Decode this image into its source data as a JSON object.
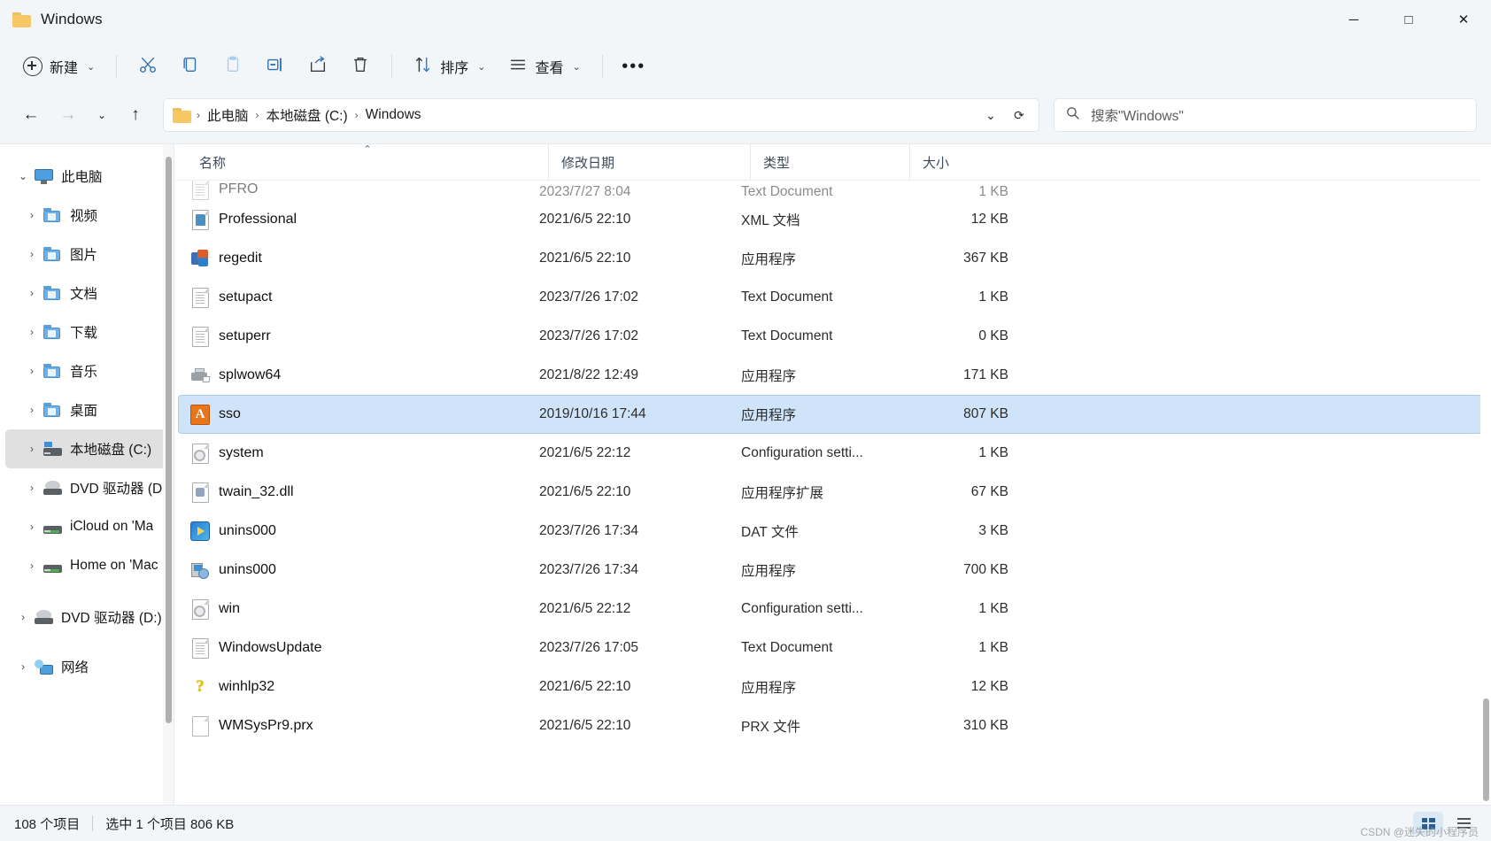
{
  "window": {
    "title": "Windows",
    "folder_icon": "folder-icon",
    "minimize_label": "─",
    "maximize_label": "□",
    "close_label": "✕"
  },
  "toolbar": {
    "new_label": "新建",
    "new_chevron": "⌄",
    "cut_icon": "cut-icon",
    "copy_icon": "copy-icon",
    "paste_icon": "paste-icon",
    "rename_icon": "rename-icon",
    "share_icon": "share-icon",
    "delete_icon": "delete-icon",
    "sort_label": "排序",
    "sort_chevron": "⌄",
    "view_label": "查看",
    "view_chevron": "⌄",
    "more_label": "•••"
  },
  "address": {
    "back_icon": "←",
    "forward_icon": "→",
    "recent_icon": "⌄",
    "up_icon": "↑",
    "breadcrumb": [
      {
        "label": "此电脑"
      },
      {
        "label": "本地磁盘 (C:)"
      },
      {
        "label": "Windows"
      }
    ],
    "separator": "›",
    "dropdown_icon": "⌄",
    "refresh_icon": "⟳",
    "search_icon": "search-icon",
    "search_placeholder": "搜索\"Windows\"",
    "search_value": ""
  },
  "sidebar": {
    "items": [
      {
        "label": "此电脑",
        "icon": "monitor-icon",
        "twisty": "⌄",
        "expanded": true,
        "indent": 0,
        "selected": false
      },
      {
        "label": "视频",
        "icon": "folder-videos-icon",
        "twisty": "›",
        "expanded": false,
        "indent": 1,
        "selected": false
      },
      {
        "label": "图片",
        "icon": "folder-pictures-icon",
        "twisty": "›",
        "expanded": false,
        "indent": 1,
        "selected": false
      },
      {
        "label": "文档",
        "icon": "folder-documents-icon",
        "twisty": "›",
        "expanded": false,
        "indent": 1,
        "selected": false
      },
      {
        "label": "下载",
        "icon": "folder-downloads-icon",
        "twisty": "›",
        "expanded": false,
        "indent": 1,
        "selected": false
      },
      {
        "label": "音乐",
        "icon": "folder-music-icon",
        "twisty": "›",
        "expanded": false,
        "indent": 1,
        "selected": false
      },
      {
        "label": "桌面",
        "icon": "folder-desktop-icon",
        "twisty": "›",
        "expanded": false,
        "indent": 1,
        "selected": false
      },
      {
        "label": "本地磁盘 (C:)",
        "icon": "drive-icon",
        "twisty": "›",
        "expanded": false,
        "indent": 1,
        "selected": true
      },
      {
        "label": "DVD 驱动器 (D",
        "icon": "cd-drive-icon",
        "twisty": "›",
        "expanded": false,
        "indent": 1,
        "selected": false
      },
      {
        "label": "iCloud on 'Ma",
        "icon": "network-drive-icon",
        "twisty": "›",
        "expanded": false,
        "indent": 1,
        "selected": false
      },
      {
        "label": "Home on 'Mac",
        "icon": "network-drive-icon",
        "twisty": "›",
        "expanded": false,
        "indent": 1,
        "selected": false
      },
      {
        "label": "DVD 驱动器 (D:)",
        "icon": "cd-drive-icon",
        "twisty": "›",
        "expanded": false,
        "indent": 0,
        "selected": false
      },
      {
        "label": "网络",
        "icon": "network-icon",
        "twisty": "›",
        "expanded": false,
        "indent": 0,
        "selected": false
      }
    ]
  },
  "filelist": {
    "columns": [
      {
        "label": "名称",
        "sorted": true,
        "sort_mark": "⌃"
      },
      {
        "label": "修改日期",
        "sorted": false,
        "sort_mark": ""
      },
      {
        "label": "类型",
        "sorted": false,
        "sort_mark": ""
      },
      {
        "label": "大小",
        "sorted": false,
        "sort_mark": ""
      }
    ],
    "partial_top_row": {
      "name": "PFRO",
      "date": "2023/7/27 8:04",
      "type": "Text Document",
      "size": "1 KB",
      "icon": "text-file-icon"
    },
    "rows": [
      {
        "name": "Professional",
        "date": "2021/6/5 22:10",
        "type": "XML 文档",
        "size": "12 KB",
        "icon": "xml-file-icon",
        "selected": false
      },
      {
        "name": "regedit",
        "date": "2021/6/5 22:10",
        "type": "应用程序",
        "size": "367 KB",
        "icon": "regedit-icon",
        "selected": false
      },
      {
        "name": "setupact",
        "date": "2023/7/26 17:02",
        "type": "Text Document",
        "size": "1 KB",
        "icon": "text-file-icon",
        "selected": false
      },
      {
        "name": "setuperr",
        "date": "2023/7/26 17:02",
        "type": "Text Document",
        "size": "0 KB",
        "icon": "text-file-icon",
        "selected": false
      },
      {
        "name": "splwow64",
        "date": "2021/8/22 12:49",
        "type": "应用程序",
        "size": "171 KB",
        "icon": "printer-icon",
        "selected": false
      },
      {
        "name": "sso",
        "date": "2019/10/16 17:44",
        "type": "应用程序",
        "size": "807 KB",
        "icon": "sso-app-icon",
        "selected": true
      },
      {
        "name": "system",
        "date": "2021/6/5 22:12",
        "type": "Configuration setti...",
        "size": "1 KB",
        "icon": "config-file-icon",
        "selected": false
      },
      {
        "name": "twain_32.dll",
        "date": "2021/6/5 22:10",
        "type": "应用程序扩展",
        "size": "67 KB",
        "icon": "dll-file-icon",
        "selected": false
      },
      {
        "name": "unins000",
        "date": "2023/7/26 17:34",
        "type": "DAT 文件",
        "size": "3 KB",
        "icon": "dat-file-icon",
        "selected": false
      },
      {
        "name": "unins000",
        "date": "2023/7/26 17:34",
        "type": "应用程序",
        "size": "700 KB",
        "icon": "installer-icon",
        "selected": false
      },
      {
        "name": "win",
        "date": "2021/6/5 22:12",
        "type": "Configuration setti...",
        "size": "1 KB",
        "icon": "config-file-icon",
        "selected": false
      },
      {
        "name": "WindowsUpdate",
        "date": "2023/7/26 17:05",
        "type": "Text Document",
        "size": "1 KB",
        "icon": "text-file-icon",
        "selected": false
      },
      {
        "name": "winhlp32",
        "date": "2021/6/5 22:10",
        "type": "应用程序",
        "size": "12 KB",
        "icon": "help-icon",
        "selected": false
      },
      {
        "name": "WMSysPr9.prx",
        "date": "2021/6/5 22:10",
        "type": "PRX 文件",
        "size": "310 KB",
        "icon": "plain-file-icon",
        "selected": false
      }
    ]
  },
  "statusbar": {
    "item_count": "108 个项目",
    "selection": "选中 1 个项目  806 KB",
    "view_grid_icon": "grid-view-icon",
    "view_list_icon": "list-view-icon",
    "watermark": "CSDN @迷失的小程序员"
  },
  "colors": {
    "accent": "#0078d4",
    "selection": "#cfe4f9",
    "chrome": "#f3f6f9",
    "sso_icon": "#e8751a"
  }
}
